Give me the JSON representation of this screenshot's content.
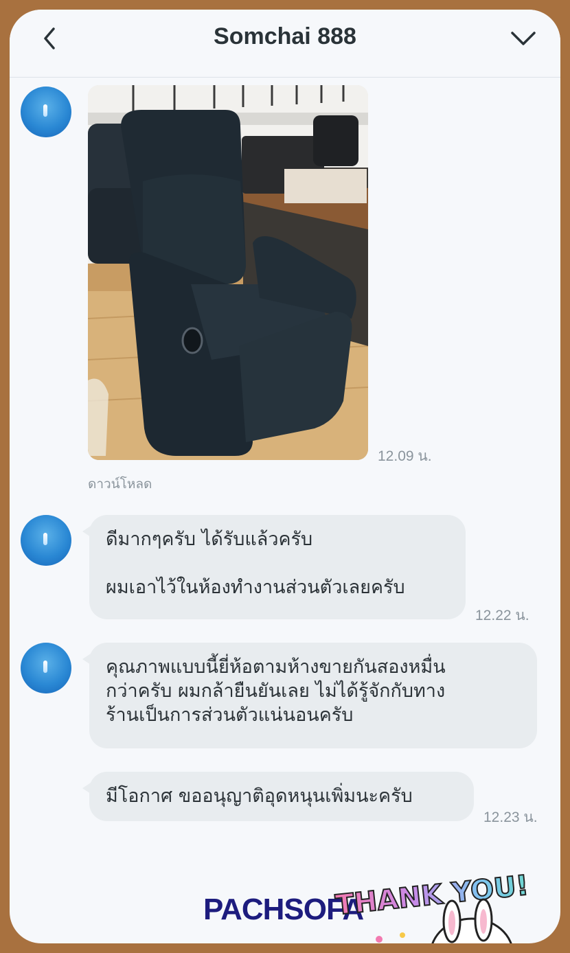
{
  "header": {
    "title": "Somchai 888",
    "back_icon": "chevron-left-icon",
    "menu_icon": "chevron-down-icon"
  },
  "messages": [
    {
      "type": "image",
      "alt": "recliner-chair-photo",
      "time": "12.09 น.",
      "caption": "ดาวน์โหลด"
    },
    {
      "type": "text",
      "lines": [
        "ดีมากๆครับ ได้รับแล้วครับ",
        "",
        "ผมเอาไว้ในห้องทำงานส่วนตัวเลยครับ"
      ],
      "time": "12.22 น."
    },
    {
      "type": "text",
      "lines": [
        "คุณภาพแบบนี้ยี่ห้อตามห้างขายกันสองหมื่น",
        "กว่าครับ ผมกล้ายืนยันเลย ไม่ได้รู้จักกับทาง",
        "ร้านเป็นการส่วนตัวแน่นอนครับ"
      ],
      "time": ""
    },
    {
      "type": "text",
      "lines": [
        "มีโอกาศ ขออนุญาติอุดหนุนเพิ่มนะครับ"
      ],
      "time": "12.23 น."
    }
  ],
  "watermark": "PACHSOFA",
  "sticker_text": "THANK YOU!",
  "colors": {
    "frame": "#a8713f",
    "bubble": "#e8ecef",
    "brand": "#1d1c7e"
  }
}
